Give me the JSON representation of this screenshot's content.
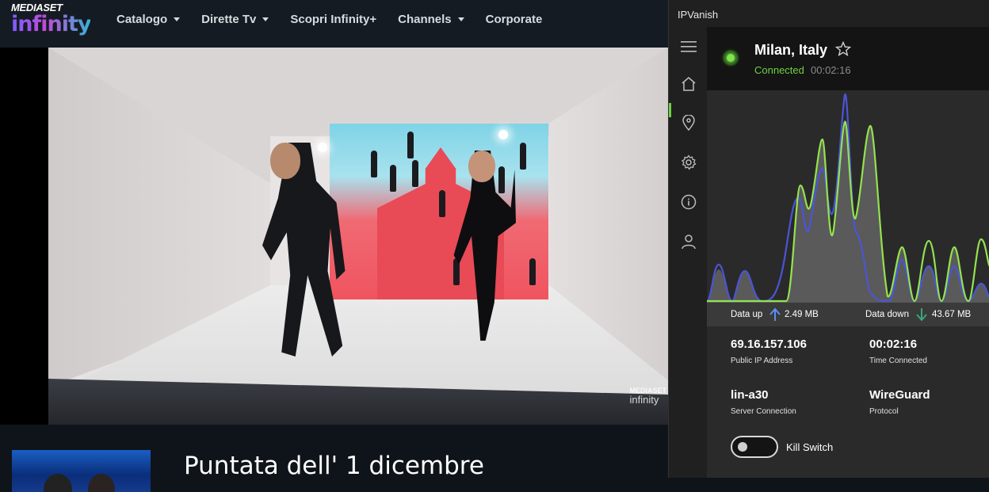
{
  "mediaset": {
    "logo_top": "MEDIASET",
    "logo_main": "infinity",
    "nav": [
      {
        "label": "Catalogo",
        "dropdown": true
      },
      {
        "label": "Dirette Tv",
        "dropdown": true
      },
      {
        "label": "Scopri Infinity+",
        "dropdown": false
      },
      {
        "label": "Channels",
        "dropdown": true
      },
      {
        "label": "Corporate",
        "dropdown": false
      }
    ],
    "watermark_top": "MEDIASET",
    "watermark_main": "infinity",
    "episode_title": "Puntata dell' 1 dicembre"
  },
  "ipvanish": {
    "window_title": "IPVanish",
    "location": "Milan, Italy",
    "status": "Connected",
    "elapsed": "00:02:16",
    "data_up_label": "Data up",
    "data_up_value": "2.49 MB",
    "data_down_label": "Data down",
    "data_down_value": "43.67 MB",
    "stats": {
      "ip": {
        "value": "69.16.157.106",
        "label": "Public IP Address"
      },
      "time": {
        "value": "00:02:16",
        "label": "Time Connected"
      },
      "server": {
        "value": "lin-a30",
        "label": "Server Connection"
      },
      "protocol": {
        "value": "WireGuard",
        "label": "Protocol"
      }
    },
    "kill_switch_label": "Kill Switch",
    "kill_switch_on": false,
    "colors": {
      "green": "#6fd044",
      "blue": "#4b55d6",
      "up_arrow": "#5b8ff0",
      "down_arrow": "#3aa57a"
    },
    "sidebar_icons": [
      "menu-icon",
      "home-icon",
      "location-pin-icon",
      "gear-icon",
      "info-icon",
      "user-icon"
    ]
  }
}
